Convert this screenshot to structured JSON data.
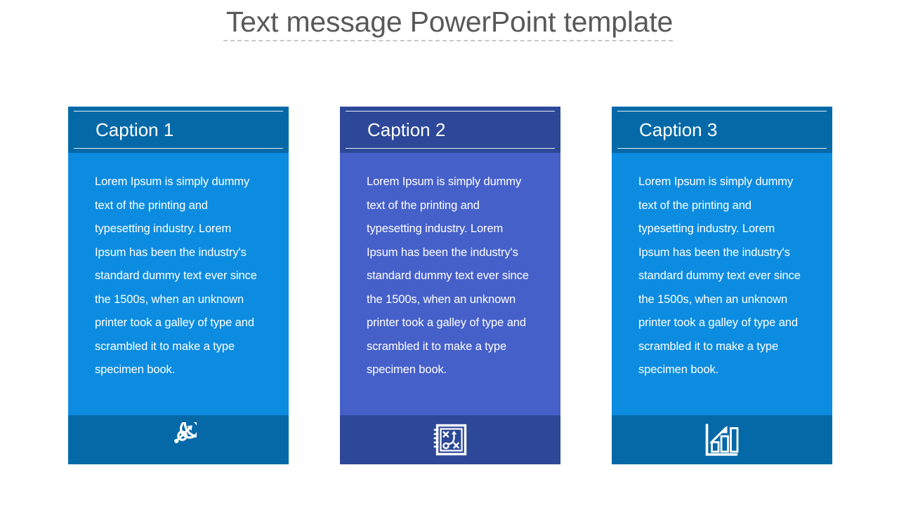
{
  "slide": {
    "title": "Text message PowerPoint template",
    "title_color": "#595959",
    "background": "#ffffff"
  },
  "body_text": "Lorem Ipsum is simply dummy text of the printing and typesetting industry. Lorem Ipsum has been the industry's standard dummy text ever since the 1500s, when an unknown printer took a galley of type and scrambled it to make a type specimen book.",
  "cards": [
    {
      "caption": "Caption 1",
      "text": "Lorem Ipsum is simply dummy text of the printing and typesetting industry. Lorem Ipsum has been the industry's standard dummy text ever since the 1500s, when an unknown printer took a galley of type and scrambled it to make a type specimen book.",
      "icon": "target-arrow-icon",
      "header_color": "#0569a8",
      "body_color": "#0c8ce0",
      "footer_color": "#0569a8",
      "icon_color": "#ffffff"
    },
    {
      "caption": "Caption 2",
      "text": "Lorem Ipsum is simply dummy text of the printing and typesetting industry. Lorem Ipsum has been the industry's standard dummy text ever since the 1500s, when an unknown printer took a galley of type and scrambled it to make a type specimen book.",
      "icon": "strategy-playbook-icon",
      "header_color": "#2d4898",
      "body_color": "#4660ca",
      "footer_color": "#2d4898",
      "icon_color": "#ffffff"
    },
    {
      "caption": "Caption 3",
      "text": "Lorem Ipsum is simply dummy text of the printing and typesetting industry. Lorem Ipsum has been the industry's standard dummy text ever since the 1500s, when an unknown printer took a galley of type and scrambled it to make a type specimen book.",
      "icon": "bar-chart-growth-icon",
      "header_color": "#0569a8",
      "body_color": "#0c8ce0",
      "footer_color": "#0569a8",
      "icon_color": "#ffffff"
    }
  ]
}
